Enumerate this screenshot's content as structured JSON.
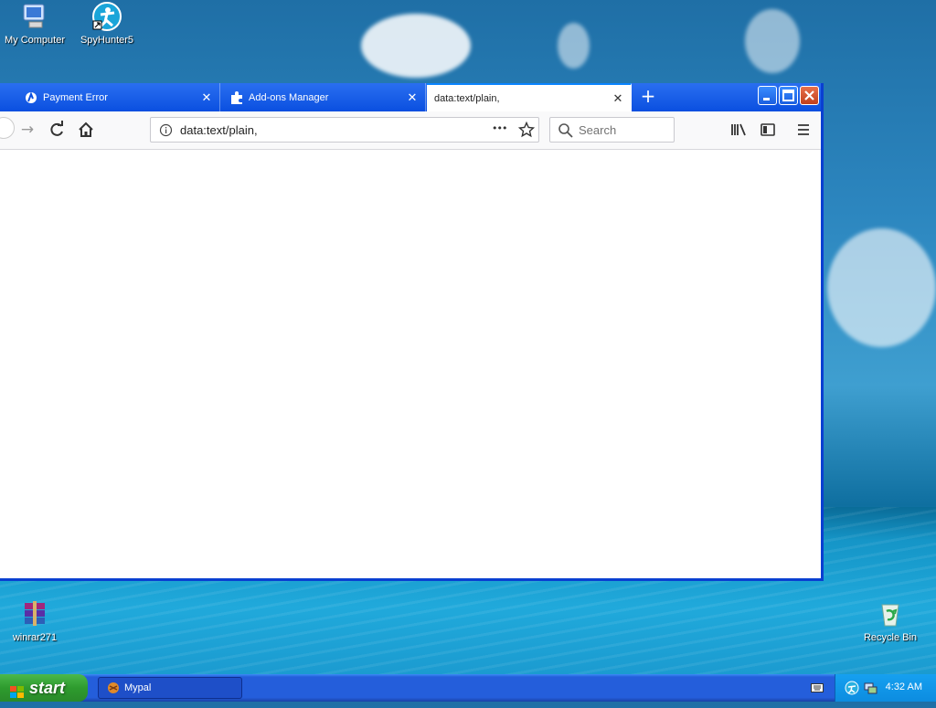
{
  "desktop": {
    "icons": [
      {
        "label": "My Computer"
      },
      {
        "label": "SpyHunter5"
      },
      {
        "label": "winrar271"
      },
      {
        "label": "Recycle Bin"
      }
    ]
  },
  "browser": {
    "tabs": [
      {
        "label": "Payment Error",
        "icon": "payment-icon",
        "active": false
      },
      {
        "label": "Add-ons Manager",
        "icon": "puzzle-icon",
        "active": false
      },
      {
        "label": "data:text/plain,",
        "icon": "",
        "active": true
      }
    ],
    "new_tab_label": "+",
    "url": "data:text/plain,",
    "search_placeholder": "Search",
    "page_actions_label": "•••"
  },
  "taskbar": {
    "start_label": "start",
    "tasks": [
      {
        "label": "Mypal"
      }
    ],
    "clock": "4:32 AM"
  },
  "colors": {
    "titlebar": "#0a4fe0",
    "taskbar": "#245edb",
    "start": "#2e9b2e"
  }
}
